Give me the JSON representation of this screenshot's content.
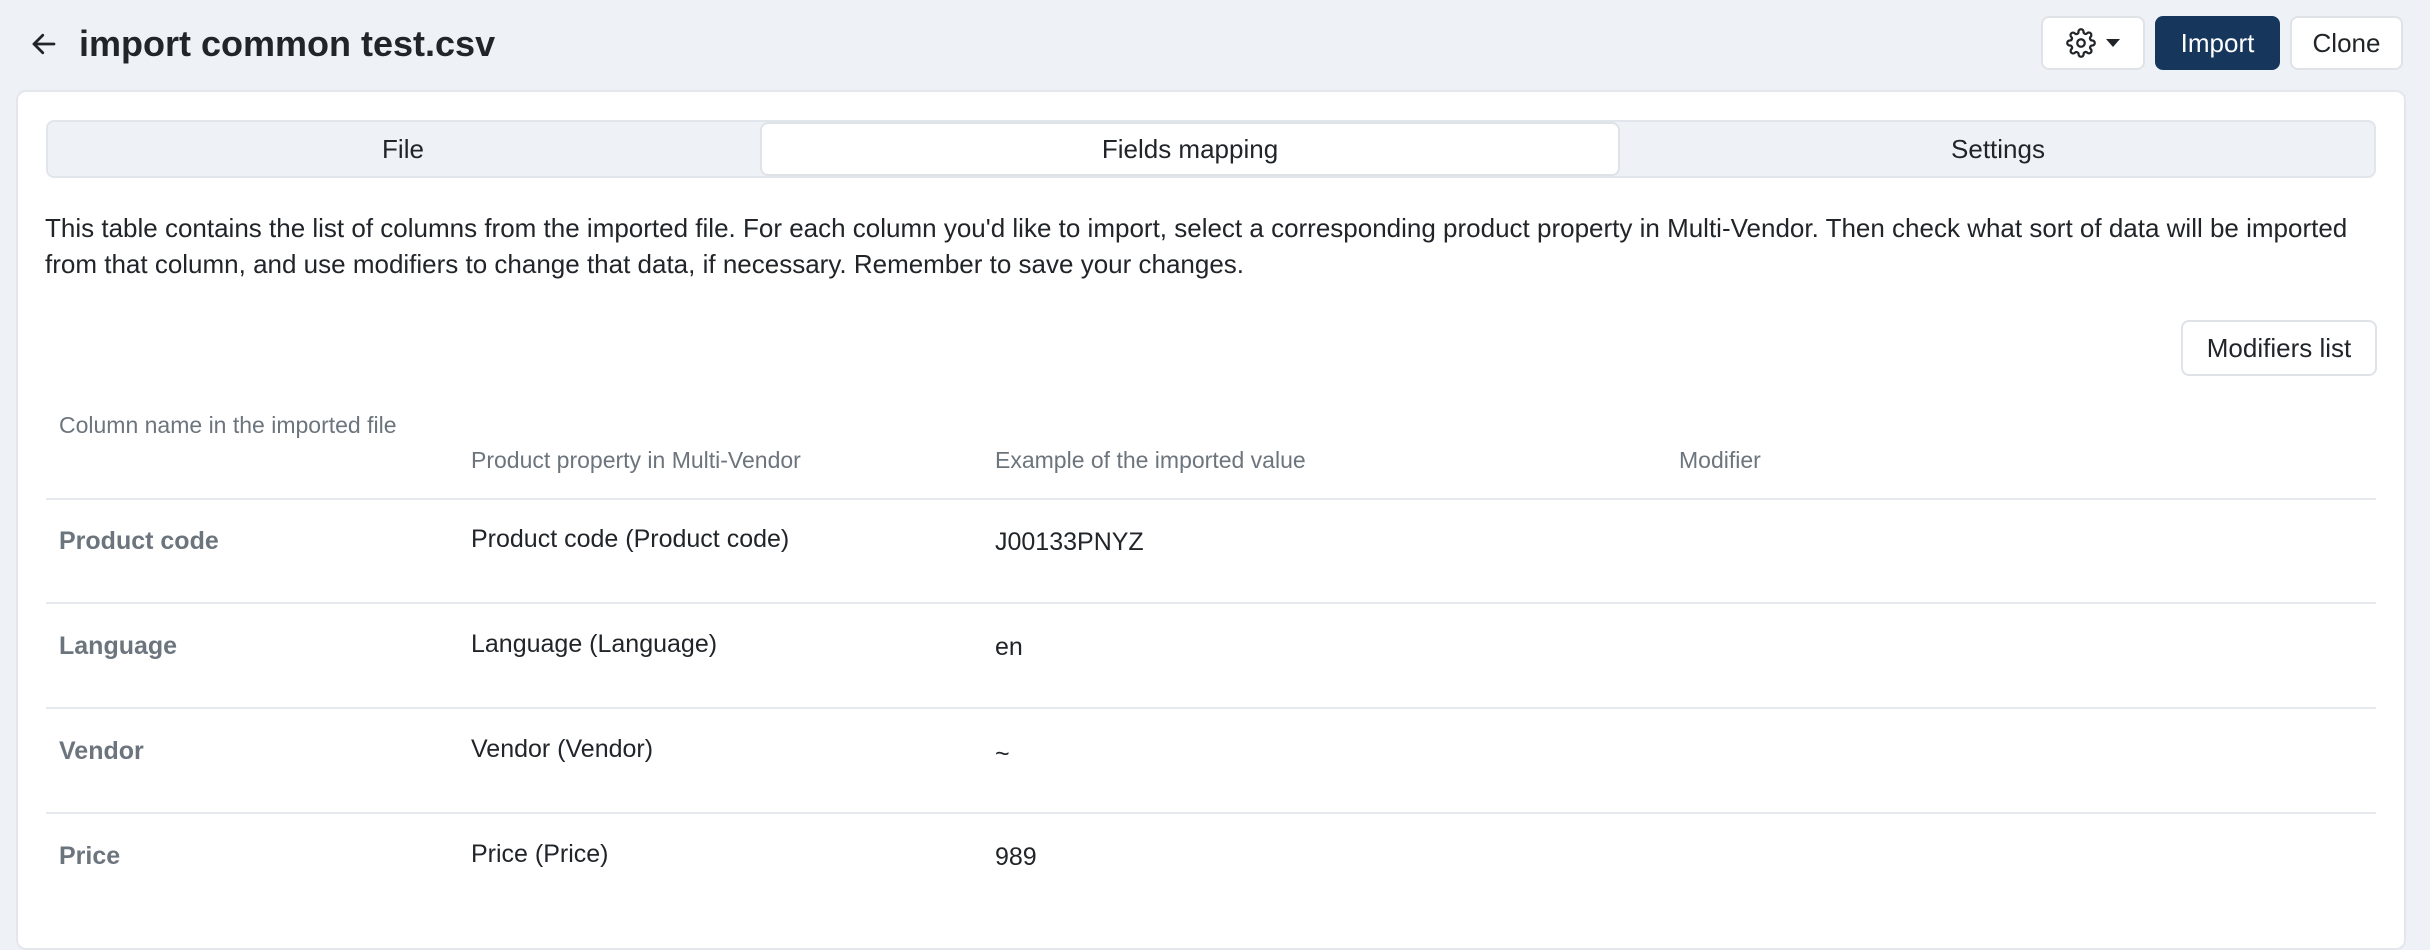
{
  "header": {
    "title": "import common test.csv",
    "import_label": "Import",
    "clone_label": "Clone"
  },
  "tabs": [
    {
      "label": "File",
      "active": false
    },
    {
      "label": "Fields mapping",
      "active": true
    },
    {
      "label": "Settings",
      "active": false
    }
  ],
  "description": "This table contains the list of columns from the imported file. For each column you'd like to import, select a corresponding product property in Multi-Vendor. Then check what sort of data will be imported from that column, and use modifiers to change that data, if necessary. Remember to save your changes.",
  "modifiers_button": "Modifiers list",
  "table": {
    "headers": {
      "column_name": "Column name in the imported file",
      "product_property": "Product property in Multi-Vendor",
      "example": "Example of the imported value",
      "modifier": "Modifier"
    },
    "rows": [
      {
        "column_name": "Product code",
        "product_property": "Product code (Product code)",
        "example": "J00133PNYZ",
        "modifier": ""
      },
      {
        "column_name": "Language",
        "product_property": "Language (Language)",
        "example": "en",
        "modifier": ""
      },
      {
        "column_name": "Vendor",
        "product_property": "Vendor (Vendor)",
        "example": "~",
        "modifier": ""
      },
      {
        "column_name": "Price",
        "product_property": "Price (Price)",
        "example": "989",
        "modifier": ""
      }
    ]
  },
  "colors": {
    "primary": "#16365c",
    "background": "#eef2f7"
  },
  "icons": {
    "back": "arrow-left-icon",
    "settings": "gear-icon"
  }
}
